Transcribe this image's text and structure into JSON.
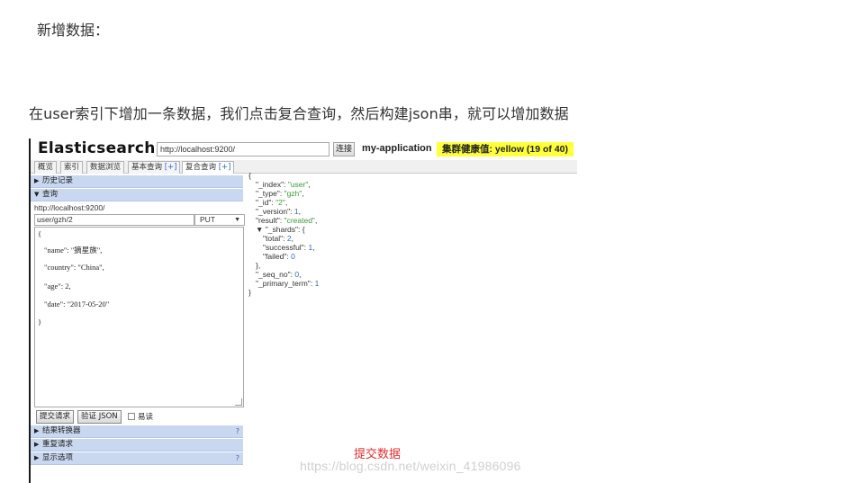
{
  "blog": {
    "heading": "新增数据：",
    "paragraph": "在user索引下增加一条数据，我们点击复合查询，然后构建json串，就可以增加数据",
    "annotation": "提交数据",
    "watermark": "https://blog.csdn.net/weixin_41986096"
  },
  "app": {
    "logo": "Elasticsearch",
    "url_value": "http://localhost:9200/",
    "connect_label": "连接",
    "cluster_name": "my-application",
    "health": "集群健康值: yellow (19 of 40)",
    "health_color": "#ffff3a"
  },
  "tabs": [
    {
      "label": "概览",
      "plus": ""
    },
    {
      "label": "索引",
      "plus": ""
    },
    {
      "label": "数据浏览",
      "plus": ""
    },
    {
      "label": "基本查询",
      "plus": "[+]"
    },
    {
      "label": "复合查询",
      "plus": "[+]"
    }
  ],
  "query_panel": {
    "history_label": "历史记录",
    "query_label": "查询",
    "endpoint": "http://localhost:9200/",
    "path": "user/gzh/2",
    "method": "PUT",
    "body_lines": [
      "{",
      "\"name\": \"摘星族\",",
      "\"country\": \"China\",",
      "\"age\": 2,",
      "\"date\": \"2017-05-20\"",
      "}"
    ],
    "submit_label": "提交请求",
    "validate_label": "验证 JSON",
    "pretty_label": "易读",
    "sections": [
      {
        "label": "结果转换器",
        "help": "?"
      },
      {
        "label": "重复请求",
        "help": ""
      },
      {
        "label": "显示选项",
        "help": "?"
      }
    ]
  },
  "response": {
    "lines": [
      {
        "indent": 0,
        "text": "{"
      },
      {
        "indent": 1,
        "key": "\"_index\": ",
        "val": "\"user\"",
        "type": "str",
        "tail": ","
      },
      {
        "indent": 1,
        "key": "\"_type\": ",
        "val": "\"gzh\"",
        "type": "str",
        "tail": ","
      },
      {
        "indent": 1,
        "key": "\"_id\": ",
        "val": "\"2\"",
        "type": "str",
        "tail": ","
      },
      {
        "indent": 1,
        "key": "\"_version\": ",
        "val": "1",
        "type": "num",
        "tail": ","
      },
      {
        "indent": 1,
        "key": "\"result\": ",
        "val": "\"created\"",
        "type": "str",
        "tail": ","
      },
      {
        "indent": 1,
        "key": "▼ \"_shards\": {",
        "val": "",
        "type": "",
        "tail": ""
      },
      {
        "indent": 2,
        "key": "\"total\": ",
        "val": "2",
        "type": "num",
        "tail": ","
      },
      {
        "indent": 2,
        "key": "\"successful\": ",
        "val": "1",
        "type": "num",
        "tail": ","
      },
      {
        "indent": 2,
        "key": "\"failed\": ",
        "val": "0",
        "type": "num",
        "tail": ""
      },
      {
        "indent": 1,
        "key": "},",
        "val": "",
        "type": "",
        "tail": ""
      },
      {
        "indent": 1,
        "key": "\"_seq_no\": ",
        "val": "0",
        "type": "num",
        "tail": ","
      },
      {
        "indent": 1,
        "key": "\"_primary_term\": ",
        "val": "1",
        "type": "num",
        "tail": ""
      },
      {
        "indent": 0,
        "text": "}"
      }
    ]
  }
}
